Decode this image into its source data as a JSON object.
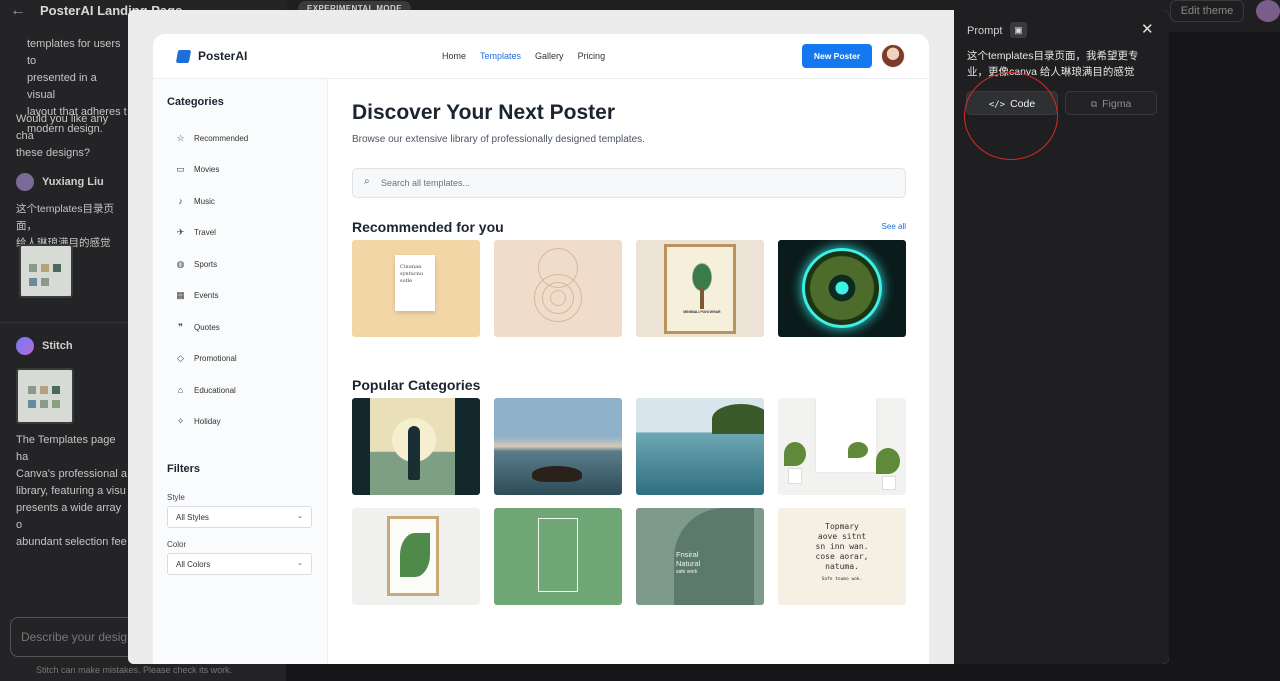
{
  "app": {
    "title": "PosterAI Landing Page",
    "experimental_badge": "EXPERIMENTAL MODE",
    "edit_theme_label": "Edit theme"
  },
  "chat": {
    "assistant_text_1": "templates for users to\npresented in a visual\nlayout that adheres t\nmodern design.",
    "assistant_question": "Would you like any cha\nthese designs?",
    "user_name": "Yuxiang Liu",
    "user_message": "这个templates目录页面，\n给人琳琅满目的感觉",
    "bot_name": "Stitch",
    "bot_message": "The Templates page ha\nCanva's professional a\nlibrary, featuring a visu\npresents a wide array o\nabundant selection fee",
    "input_placeholder": "Describe your desig",
    "disclaimer": "Stitch can make mistakes. Please check its work."
  },
  "preview": {
    "brand": "PosterAI",
    "nav": [
      "Home",
      "Templates",
      "Gallery",
      "Pricing"
    ],
    "new_poster_label": "New Poster",
    "categories_heading": "Categories",
    "categories": [
      {
        "label": "Recommended",
        "icon": "star-icon"
      },
      {
        "label": "Movies",
        "icon": "film-icon"
      },
      {
        "label": "Music",
        "icon": "music-note-icon"
      },
      {
        "label": "Travel",
        "icon": "airplane-icon"
      },
      {
        "label": "Sports",
        "icon": "ball-icon"
      },
      {
        "label": "Events",
        "icon": "calendar-icon"
      },
      {
        "label": "Quotes",
        "icon": "quote-icon"
      },
      {
        "label": "Promotional",
        "icon": "tag-icon"
      },
      {
        "label": "Educational",
        "icon": "graduation-cap-icon"
      },
      {
        "label": "Holiday",
        "icon": "party-icon"
      }
    ],
    "filters_heading": "Filters",
    "style_label": "Style",
    "style_value": "All Styles",
    "color_label": "Color",
    "color_value": "All Colors",
    "headline": "Discover Your Next Poster",
    "subheadline": "Browse our extensive library of professionally designed templates.",
    "search_placeholder": "Search all templates...",
    "recommended_heading": "Recommended for you",
    "see_all_label": "See all",
    "popular_heading": "Popular Categories",
    "card_texts": {
      "paper": "Cinunan\nsyntucnu\nsotle",
      "palm_title": "MINIMALI PUNI WHAR",
      "green_title": "Fnsiral\nNatural",
      "green_sub": "safe work",
      "quote": "Topmary\naove sitnt\nsn inn wan.\ncose aorar,\nnatuma.",
      "quote_sub": "Safe toumo wok."
    },
    "accent_color": "#1478f0"
  },
  "prompt_panel": {
    "label": "Prompt",
    "text": "这个templates目录页面，我希望更专业，更像canva 给人琳琅满目的感觉",
    "code_tab": "Code",
    "figma_tab": "Figma"
  }
}
